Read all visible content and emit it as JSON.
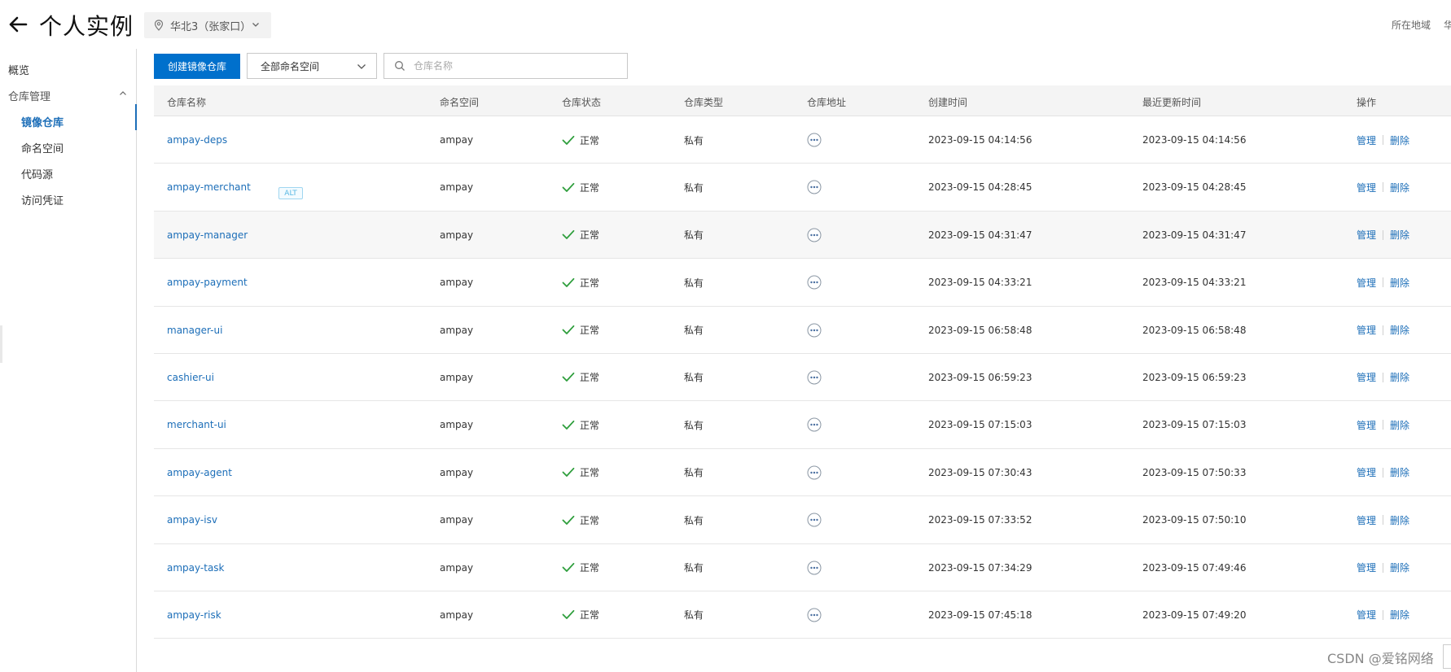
{
  "header": {
    "title": "个人实例",
    "region": "华北3（张家口）",
    "region_label": "所在地域",
    "region_value": "华"
  },
  "sidebar": {
    "overview": "概览",
    "group_label": "仓库管理",
    "items": [
      {
        "label": "镜像仓库",
        "active": true
      },
      {
        "label": "命名空间",
        "active": false
      },
      {
        "label": "代码源",
        "active": false
      },
      {
        "label": "访问凭证",
        "active": false
      }
    ]
  },
  "toolbar": {
    "create_label": "创建镜像仓库",
    "namespace_select": "全部命名空间",
    "search_placeholder": "仓库名称"
  },
  "table": {
    "columns": [
      "仓库名称",
      "命名空间",
      "仓库状态",
      "仓库类型",
      "仓库地址",
      "创建时间",
      "最近更新时间",
      "操作"
    ],
    "rows": [
      {
        "name": "ampay-deps",
        "namespace": "ampay",
        "status": "正常",
        "type": "私有",
        "created": "2023-09-15 04:14:56",
        "updated": "2023-09-15 04:14:56"
      },
      {
        "name": "ampay-merchant",
        "namespace": "ampay",
        "status": "正常",
        "type": "私有",
        "created": "2023-09-15 04:28:45",
        "updated": "2023-09-15 04:28:45",
        "badge": "ALT"
      },
      {
        "name": "ampay-manager",
        "namespace": "ampay",
        "status": "正常",
        "type": "私有",
        "created": "2023-09-15 04:31:47",
        "updated": "2023-09-15 04:31:47",
        "highlighted": true
      },
      {
        "name": "ampay-payment",
        "namespace": "ampay",
        "status": "正常",
        "type": "私有",
        "created": "2023-09-15 04:33:21",
        "updated": "2023-09-15 04:33:21"
      },
      {
        "name": "manager-ui",
        "namespace": "ampay",
        "status": "正常",
        "type": "私有",
        "created": "2023-09-15 06:58:48",
        "updated": "2023-09-15 06:58:48"
      },
      {
        "name": "cashier-ui",
        "namespace": "ampay",
        "status": "正常",
        "type": "私有",
        "created": "2023-09-15 06:59:23",
        "updated": "2023-09-15 06:59:23"
      },
      {
        "name": "merchant-ui",
        "namespace": "ampay",
        "status": "正常",
        "type": "私有",
        "created": "2023-09-15 07:15:03",
        "updated": "2023-09-15 07:15:03"
      },
      {
        "name": "ampay-agent",
        "namespace": "ampay",
        "status": "正常",
        "type": "私有",
        "created": "2023-09-15 07:30:43",
        "updated": "2023-09-15 07:50:33"
      },
      {
        "name": "ampay-isv",
        "namespace": "ampay",
        "status": "正常",
        "type": "私有",
        "created": "2023-09-15 07:33:52",
        "updated": "2023-09-15 07:50:10"
      },
      {
        "name": "ampay-task",
        "namespace": "ampay",
        "status": "正常",
        "type": "私有",
        "created": "2023-09-15 07:34:29",
        "updated": "2023-09-15 07:49:46"
      },
      {
        "name": "ampay-risk",
        "namespace": "ampay",
        "status": "正常",
        "type": "私有",
        "created": "2023-09-15 07:45:18",
        "updated": "2023-09-15 07:49:20"
      }
    ],
    "action_manage": "管理",
    "action_delete": "删除"
  },
  "watermark": "CSDN @爱铭网络",
  "colors": {
    "primary": "#0070cc",
    "link": "#1c6eb8",
    "success": "#2e9e3c"
  }
}
